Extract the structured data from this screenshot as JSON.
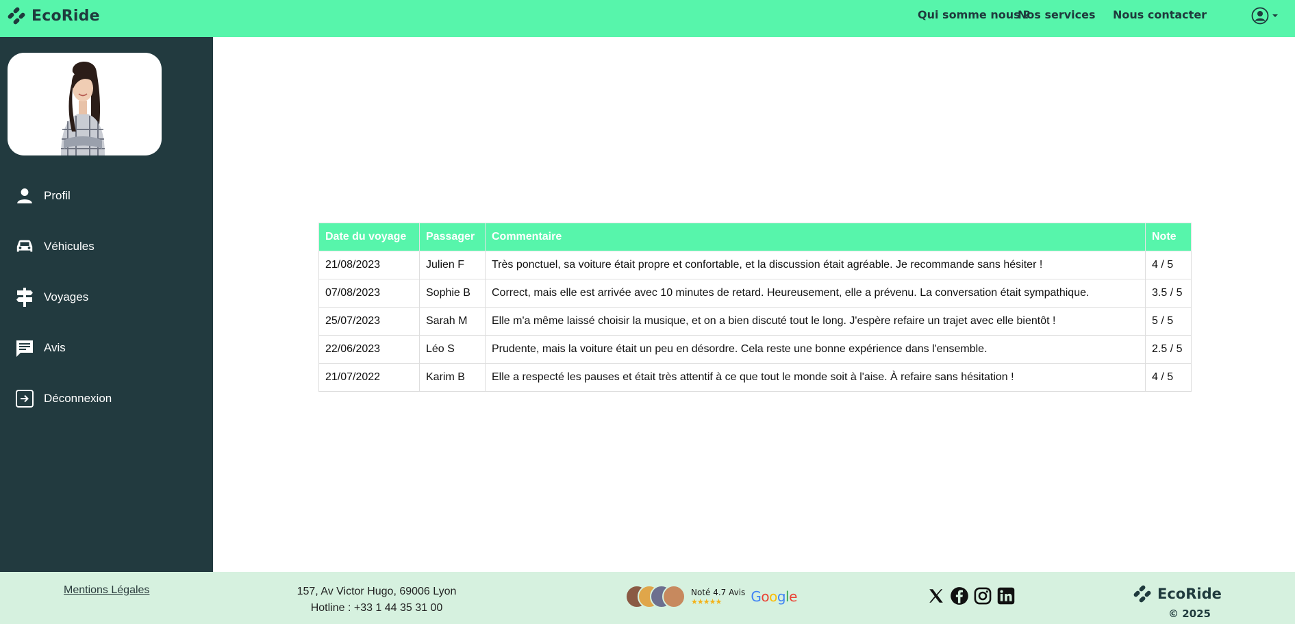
{
  "header": {
    "brand": "EcoRide",
    "nav": [
      "Qui somme nous ?",
      "Nos services",
      "Nous contacter"
    ],
    "user_icon": "user-circle-icon",
    "caret_icon": "caret-down-icon"
  },
  "sidebar": {
    "avatar": "profile-photo",
    "items": [
      {
        "label": "Profil",
        "icon": "person-icon"
      },
      {
        "label": "Véhicules",
        "icon": "car-icon"
      },
      {
        "label": "Voyages",
        "icon": "signpost-icon"
      },
      {
        "label": "Avis",
        "icon": "comment-icon"
      },
      {
        "label": "Déconnexion",
        "icon": "logout-icon"
      }
    ]
  },
  "reviews": {
    "headers": [
      "Date du voyage",
      "Passager",
      "Commentaire",
      "Note"
    ],
    "rows": [
      {
        "date": "21/08/2023",
        "passenger": "Julien F",
        "comment": "Très ponctuel, sa voiture était propre et confortable, et la discussion était agréable. Je recommande sans hésiter !",
        "note": "4 / 5"
      },
      {
        "date": "07/08/2023",
        "passenger": "Sophie B",
        "comment": "Correct, mais elle est arrivée avec 10 minutes de retard. Heureusement, elle a prévenu. La conversation était sympathique.",
        "note": "3.5 / 5"
      },
      {
        "date": "25/07/2023",
        "passenger": "Sarah M",
        "comment": "Elle m'a même laissé choisir la musique, et on a bien discuté tout le long. J'espère refaire un trajet avec elle bientôt !",
        "note": "5 / 5"
      },
      {
        "date": "22/06/2023",
        "passenger": "Léo S",
        "comment": "Prudente, mais la voiture était un peu en désordre. Cela reste une bonne expérience dans l'ensemble.",
        "note": "2.5 / 5"
      },
      {
        "date": "21/07/2022",
        "passenger": "Karim B",
        "comment": "Elle a respecté les pauses et était très attentif à ce que tout le monde soit à l'aise. À refaire sans hésitation !",
        "note": "4 / 5"
      }
    ]
  },
  "footer": {
    "legal": "Mentions Légales",
    "address_line1": "157, Av Victor Hugo, 69006 Lyon",
    "address_line2": "Hotline : +33 1 44 35 31 00",
    "rating_label": "Noté 4.7 Avis",
    "rating_value": 4.7,
    "stars": "★★★★★",
    "google": "Google",
    "socials": [
      "x-icon",
      "facebook-icon",
      "instagram-icon",
      "linkedin-icon"
    ],
    "brand": "EcoRide",
    "copyright": "© 2025"
  },
  "colors": {
    "header_bg": "#57f5ab",
    "sidebar_bg": "#223a3f",
    "footer_bg": "#d6f1df",
    "table_header_bg": "#57f5ab"
  }
}
